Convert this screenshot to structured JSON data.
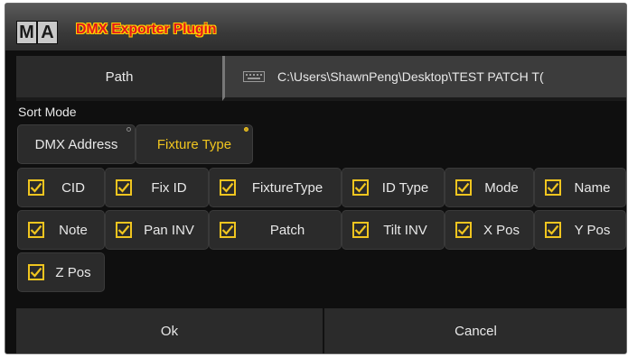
{
  "window": {
    "logo": [
      "M",
      "A"
    ],
    "title": "DMX Exporter Plugin"
  },
  "path": {
    "button_label": "Path",
    "value": "C:\\Users\\ShawnPeng\\Desktop\\TEST PATCH T("
  },
  "sort": {
    "label": "Sort Mode",
    "options": [
      {
        "label": "DMX Address",
        "selected": false
      },
      {
        "label": "Fixture Type",
        "selected": true
      }
    ]
  },
  "columns": [
    {
      "label": "CID",
      "checked": true
    },
    {
      "label": "Fix ID",
      "checked": true
    },
    {
      "label": "FixtureType",
      "checked": true
    },
    {
      "label": "ID Type",
      "checked": true
    },
    {
      "label": "Mode",
      "checked": true
    },
    {
      "label": "Name",
      "checked": true
    },
    {
      "label": "Note",
      "checked": true
    },
    {
      "label": "Pan INV",
      "checked": true
    },
    {
      "label": "Patch",
      "checked": true
    },
    {
      "label": "Tilt INV",
      "checked": true
    },
    {
      "label": "X Pos",
      "checked": true
    },
    {
      "label": "Y Pos",
      "checked": true
    },
    {
      "label": "Z Pos",
      "checked": true
    }
  ],
  "actions": {
    "ok": "Ok",
    "cancel": "Cancel"
  },
  "colors": {
    "accent": "#f0c51f",
    "title_red": "#e2171d",
    "button_bg": "#2b2b2b",
    "panel_bg": "#0f0f0f"
  }
}
